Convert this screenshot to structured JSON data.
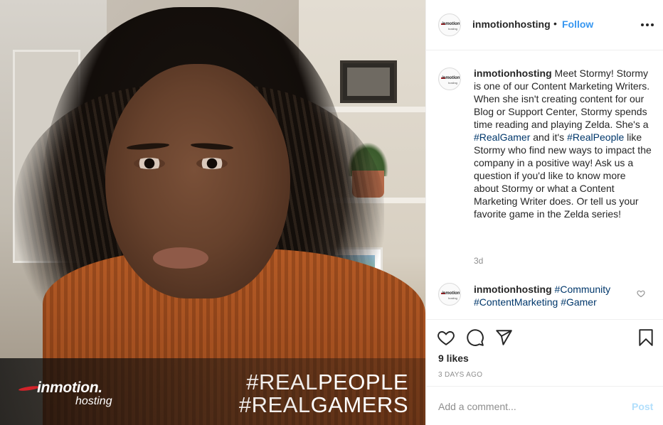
{
  "post_image": {
    "brand_logo_main": "inmotion.",
    "brand_logo_sub": "hosting",
    "tag_line_1": {
      "hash_light": "#REAL",
      "word": "PEOPLE"
    },
    "tag_line_2": {
      "hash_light": "#REAL",
      "word": "GAMERS"
    }
  },
  "header": {
    "username": "inmotionhosting",
    "separator": "•",
    "follow_label": "Follow",
    "avatar_text": "inmotion",
    "avatar_sub": "hosting"
  },
  "caption": {
    "username": "inmotionhosting",
    "text_1": " Meet Stormy! Stormy is one of our Content Marketing Writers. When she isn't creating content for our Blog or Support Center, Stormy spends time reading and playing Zelda. She's a ",
    "hashtag_1": "#RealGamer",
    "text_2": " and it's ",
    "hashtag_2": "#RealPeople",
    "text_3": " like Stormy who find new ways to impact the company in a positive way! Ask us a question if you'd like to know more about Stormy or what a Content Marketing Writer does. Or tell us your favorite game in the Zelda series!",
    "time": "3d"
  },
  "comment": {
    "username": "inmotionhosting",
    "hashtag_1": "#Community",
    "hashtag_2": "#ContentMarketing",
    "hashtag_3": "#Gamer"
  },
  "actions": {
    "likes": "9 likes",
    "date": "3 DAYS AGO",
    "icons": [
      "heart-icon",
      "comment-icon",
      "share-icon",
      "bookmark-icon"
    ]
  },
  "add_comment": {
    "placeholder": "Add a comment...",
    "post_label": "Post"
  },
  "colors": {
    "link_blue": "#3897f0",
    "hashtag_blue": "#00376b",
    "post_disabled": "#b2dffc",
    "brand_red": "#d2232a"
  }
}
